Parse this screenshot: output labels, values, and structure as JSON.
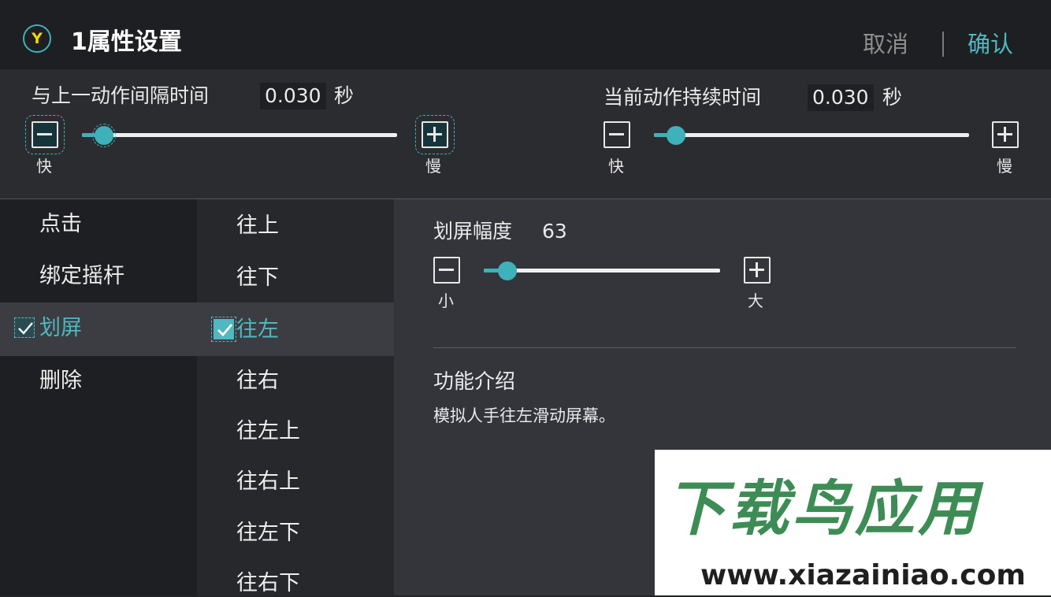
{
  "header": {
    "logo_letter": "Y",
    "title": "1属性设置",
    "cancel_label": "取消",
    "confirm_label": "确认"
  },
  "interval": {
    "label": "与上一动作间隔时间",
    "value": "0.030",
    "unit": "秒",
    "minus_label": "快",
    "plus_label": "慢",
    "slider_fraction": 0.07
  },
  "duration": {
    "label": "当前动作持续时间",
    "value": "0.030",
    "unit": "秒",
    "minus_label": "快",
    "plus_label": "慢",
    "slider_fraction": 0.07
  },
  "actions": {
    "items": [
      {
        "label": "点击"
      },
      {
        "label": "绑定摇杆"
      },
      {
        "label": "划屏",
        "checked": true
      },
      {
        "label": "删除"
      }
    ]
  },
  "directions": {
    "items": [
      {
        "label": "往上"
      },
      {
        "label": "往下"
      },
      {
        "label": "往左",
        "checked": true
      },
      {
        "label": "往右"
      },
      {
        "label": "往左上"
      },
      {
        "label": "往右上"
      },
      {
        "label": "往左下"
      },
      {
        "label": "往右下"
      }
    ]
  },
  "swipe": {
    "label": "划屏幅度",
    "value": "63",
    "minus_label": "小",
    "plus_label": "大",
    "slider_fraction": 0.1
  },
  "intro": {
    "heading": "功能介绍",
    "text": "模拟人手往左滑动屏幕。"
  },
  "watermark": {
    "brand": "下载鸟应用",
    "url": "www.xiazainiao.com"
  },
  "colors": {
    "accent": "#3fb1bb",
    "logo_letter": "#f2d600",
    "watermark_green": "#3e8c55"
  }
}
